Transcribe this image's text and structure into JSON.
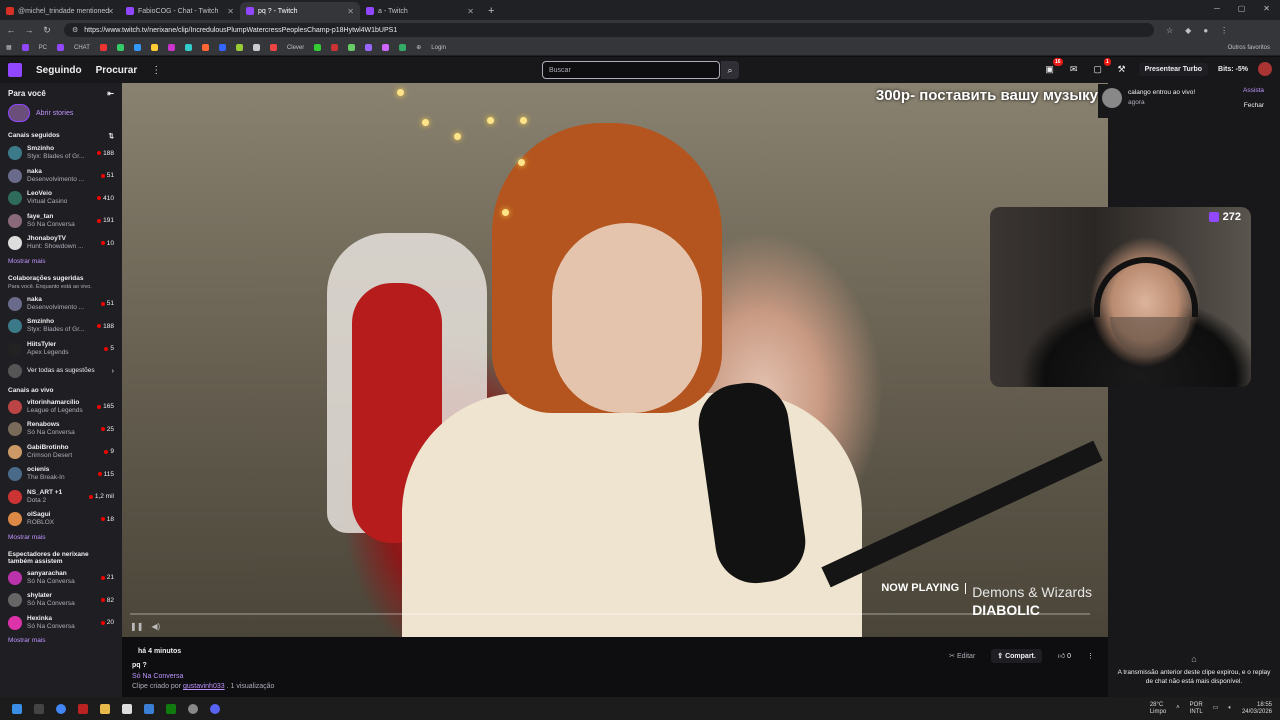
{
  "browser": {
    "tabs": [
      {
        "label": "@michel_trindade mentioned",
        "active": false
      },
      {
        "label": "FabioCOG - Chat - Twitch",
        "active": false
      },
      {
        "label": "pq ? - Twitch",
        "active": true
      },
      {
        "label": "a - Twitch",
        "active": false
      }
    ],
    "url": "https://www.twitch.tv/nerixane/clip/IncredulousPlumpWatercressPeoplesChamp-p18Hytwl4W1bUPS1",
    "bookmarks": [
      "PC",
      "CHAT",
      "Clever",
      "Login"
    ],
    "bookmarks_other": "Outros favoritos"
  },
  "twitch_nav": {
    "following": "Seguindo",
    "browse": "Procurar",
    "search_placeholder": "Buscar",
    "notifications_count": "16",
    "inbox_count": "1",
    "turbo_label": "Presentear Turbo",
    "bits_label": "Bits: -5%"
  },
  "sidebar": {
    "header": "Para você",
    "stories": "Abrir stories",
    "followed_title": "Canais seguidos",
    "followed": [
      {
        "name": "Smzinho",
        "game": "Styx: Blades of Gr...",
        "viewers": "188",
        "color": "#3c7a8a"
      },
      {
        "name": "naka",
        "game": "Desenvolvimento ...",
        "viewers": "51",
        "color": "#6a6a8a"
      },
      {
        "name": "LeoVeio",
        "game": "Virtual Casino",
        "viewers": "410",
        "color": "#2f6b5a"
      },
      {
        "name": "faye_tan",
        "game": "Só Na Conversa",
        "viewers": "191",
        "color": "#8a6a7a"
      },
      {
        "name": "JhonaboyTV",
        "game": "Hunt: Showdown ...",
        "viewers": "10",
        "color": "#ddd"
      }
    ],
    "show_more_1": "Mostrar mais",
    "suggested_title": "Colaborações sugeridas",
    "suggested_sub": "Para você. Enquanto está ao vivo.",
    "suggested": [
      {
        "name": "naka",
        "game": "Desenvolvimento ...",
        "viewers": "51",
        "color": "#6a6a8a"
      },
      {
        "name": "Smzinho",
        "game": "Styx: Blades of Gr...",
        "viewers": "188",
        "color": "#3c7a8a"
      },
      {
        "name": "HiitsTyler",
        "game": "Apex Legends",
        "viewers": "5",
        "color": "#222"
      }
    ],
    "see_all": "Ver todas as sugestões",
    "live_title": "Canais ao vivo",
    "live": [
      {
        "name": "vitorinhamarcilio",
        "game": "League of Legends",
        "viewers": "165",
        "color": "#b44"
      },
      {
        "name": "Renabows",
        "game": "Só Na Conversa",
        "viewers": "25",
        "color": "#7a6a5a"
      },
      {
        "name": "GabiBrotinho",
        "game": "Crimson Desert",
        "viewers": "9",
        "color": "#c96"
      },
      {
        "name": "ocienis",
        "game": "The Break-In",
        "viewers": "115",
        "color": "#4a6a8a"
      },
      {
        "name": "NS_ART +1",
        "game": "Dota 2",
        "viewers": "1,2 mil",
        "color": "#c33"
      },
      {
        "name": "olSagui",
        "game": "ROBLOX",
        "viewers": "18",
        "color": "#d84"
      }
    ],
    "show_more_2": "Mostrar mais",
    "viewers_title": "Espectadores de nerixane também assistem",
    "viewers_list": [
      {
        "name": "sanyarachan",
        "game": "Só Na Conversa",
        "viewers": "21",
        "color": "#b3a"
      },
      {
        "name": "shylater",
        "game": "Só Na Conversa",
        "viewers": "82",
        "color": "#666"
      },
      {
        "name": "Hexinka",
        "game": "Só Na Conversa",
        "viewers": "20",
        "color": "#d3a"
      }
    ],
    "show_more_3": "Mostrar mais"
  },
  "player": {
    "overlay_text": "300р- поставить вашу музыку",
    "now_playing_label": "NOW PLAYING",
    "artist": "Demons & Wizards",
    "song": "DIABOLIC",
    "cam_count": "272"
  },
  "toast": {
    "message": "calango entrou ao vivo!",
    "time": "agora",
    "watch": "Assista",
    "close": "Fechar"
  },
  "clip": {
    "time": "há 4 minutos",
    "title": "pq ?",
    "category": "Só Na Conversa",
    "created_by_prefix": "Clipe criado por",
    "creator": "gustavinh033",
    "views": ". 1 visualização",
    "edit": "Editar",
    "share": "Compart.",
    "likes": "0"
  },
  "chat": {
    "expired_msg": "A transmissão anterior deste clipe expirou, e o replay de chat não está mais disponível."
  },
  "taskbar": {
    "weather_temp": "28°C",
    "weather_desc": "Limpo",
    "lang": "POR",
    "layout": "INTL",
    "time": "18:55",
    "date": "24/03/2026"
  }
}
